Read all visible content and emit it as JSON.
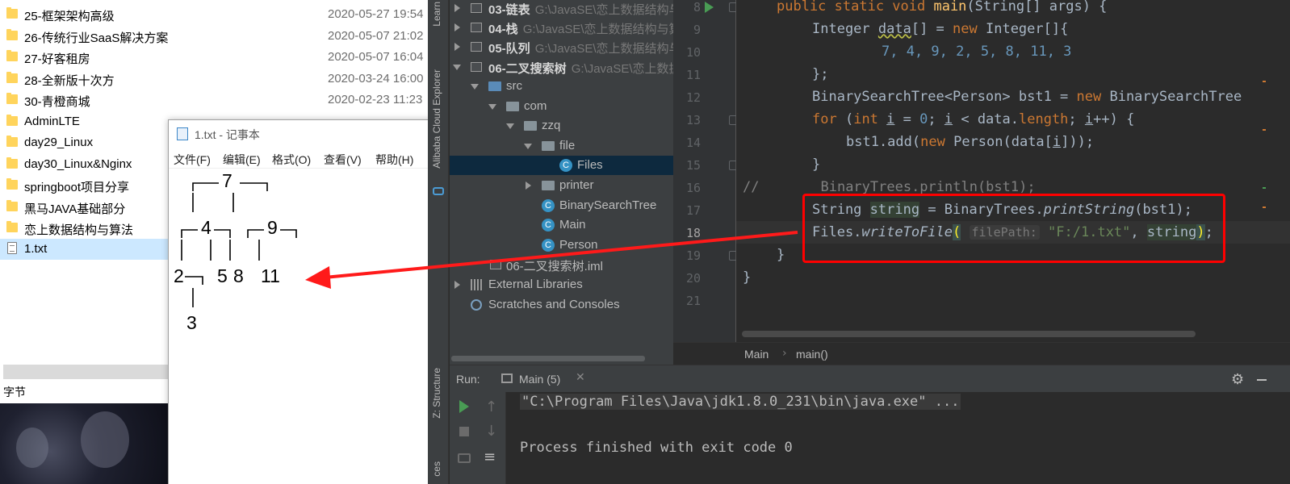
{
  "explorer": {
    "files": [
      {
        "name": "25-框架架构高级",
        "date": "2020-05-27 19:54"
      },
      {
        "name": "26-传统行业SaaS解决方案",
        "date": "2020-05-07 21:02"
      },
      {
        "name": "27-好客租房",
        "date": "2020-05-07 16:04"
      },
      {
        "name": "28-全新版十次方",
        "date": "2020-03-24 16:00"
      },
      {
        "name": "30-青橙商城",
        "date": "2020-02-23 11:23"
      },
      {
        "name": "AdminLTE",
        "date": ""
      },
      {
        "name": "day29_Linux",
        "date": ""
      },
      {
        "name": "day30_Linux&Nginx",
        "date": ""
      },
      {
        "name": "springboot项目分享",
        "date": ""
      },
      {
        "name": "黑马JAVA基础部分",
        "date": ""
      },
      {
        "name": "恋上数据结构与算法",
        "date": ""
      },
      {
        "name": "1.txt",
        "date": ""
      }
    ],
    "status": "字节"
  },
  "notepad": {
    "title": "1.txt - 记事本",
    "menus": [
      "文件(F)",
      "编辑(E)",
      "格式(O)",
      "查看(V)",
      "帮助(H)"
    ],
    "tree_nodes": [
      "7",
      "4",
      "9",
      "2",
      "5",
      "8",
      "11",
      "3"
    ]
  },
  "side_strip": {
    "tabs": [
      "Learn",
      "Alibaba Cloud Explorer",
      "Z: Structure",
      "ces"
    ]
  },
  "project": {
    "rows": [
      {
        "label": "03-链表",
        "path": "G:\\JavaSE\\恋上数据结构与",
        "bold": true
      },
      {
        "label": "04-栈",
        "path": "G:\\JavaSE\\恋上数据结构与算",
        "bold": true
      },
      {
        "label": "05-队列",
        "path": "G:\\JavaSE\\恋上数据结构与",
        "bold": true
      },
      {
        "label": "06-二叉搜索树",
        "path": "G:\\JavaSE\\恋上数据",
        "bold": true
      },
      {
        "label": "src",
        "path": "",
        "bold": false
      },
      {
        "label": "com",
        "path": "",
        "bold": false
      },
      {
        "label": "zzq",
        "path": "",
        "bold": false
      },
      {
        "label": "file",
        "path": "",
        "bold": false
      },
      {
        "label": "Files",
        "path": "",
        "bold": false
      },
      {
        "label": "printer",
        "path": "",
        "bold": false
      },
      {
        "label": "BinarySearchTree",
        "path": "",
        "bold": false
      },
      {
        "label": "Main",
        "path": "",
        "bold": false
      },
      {
        "label": "Person",
        "path": "",
        "bold": false
      },
      {
        "label": "06-二叉搜索树.iml",
        "path": "",
        "bold": false
      },
      {
        "label": "External Libraries",
        "path": "",
        "bold": false
      },
      {
        "label": "Scratches and Consoles",
        "path": "",
        "bold": false
      }
    ]
  },
  "editor": {
    "line_numbers": [
      "8",
      "9",
      "10",
      "11",
      "12",
      "13",
      "14",
      "15",
      "16",
      "17",
      "18",
      "19",
      "20",
      "21"
    ],
    "current_line": "18",
    "code": {
      "l8_kw": "public static void ",
      "l8_fn": "main",
      "l8_rest": "(String[] args) {",
      "l9_a": "Integer ",
      "l9_var": "data",
      "l9_b": "[] = ",
      "l9_kw": "new ",
      "l9_c": "Integer[]{",
      "l10": "7, 4, 9, 2, 5, 8, 11, 3",
      "l11": "};",
      "l12_a": "BinarySearchTree<Person> bst1 = ",
      "l12_kw": "new ",
      "l12_b": "BinarySearchTree",
      "l13_kw": "for ",
      "l13_a": "(",
      "l13_kw2": "int ",
      "l13_i": "i",
      "l13_b": " = ",
      "l13_num": "0",
      "l13_c": "; ",
      "l13_d": " < data.",
      "l13_e": "length",
      "l13_f": "; ",
      "l13_g": "++) {",
      "l14_a": "bst1.add(",
      "l14_kw": "new ",
      "l14_b": "Person(data[",
      "l14_c": "]));",
      "l15": "}",
      "l16_slash": "//",
      "l16_code": "BinaryTrees.println(bst1);",
      "l17_a": "String ",
      "l17_var": "string",
      "l17_b": " = BinaryTrees.",
      "l17_fn": "printString",
      "l17_c": "(bst1);",
      "l18_a": "Files.",
      "l18_fn": "writeToFile",
      "l18_paren": "(",
      "l18_hint": "filePath:",
      "l18_str": "\"F:/1.txt\"",
      "l18_b": ", ",
      "l18_var": "string",
      "l18_paren2": ")",
      "l18_end": ";",
      "l19": "}",
      "l20": "}"
    }
  },
  "breadcrumb": {
    "items": [
      "Main",
      "main()"
    ]
  },
  "run": {
    "label": "Run:",
    "tab": "Main (5)",
    "console": [
      "\"C:\\Program Files\\Java\\jdk1.8.0_231\\bin\\java.exe\" ...",
      "",
      "Process finished with exit code 0"
    ]
  },
  "colors": {
    "annotation_red": "#ff0000",
    "ide_bg": "#2b2b2b",
    "keyword": "#cc7832"
  }
}
